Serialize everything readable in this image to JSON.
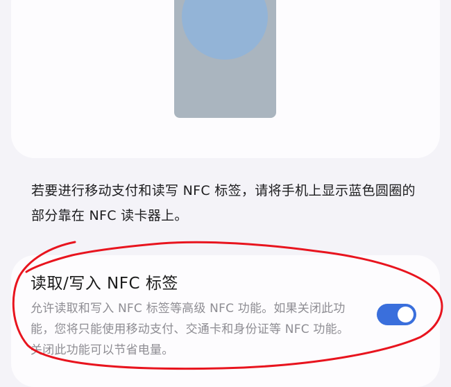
{
  "instruction": {
    "text": "若要进行移动支付和读写 NFC 标签，请将手机上显示蓝色圆圈的部分靠在 NFC 读卡器上。"
  },
  "setting": {
    "title": "读取/写入 NFC 标签",
    "description": "允许读取和写入 NFC 标签等高级 NFC 功能。如果关闭此功能，您将只能使用移动支付、交通卡和身份证等 NFC 功能。关闭此功能可以节省电量。",
    "toggle_on": true
  },
  "colors": {
    "accent": "#3a6fdc",
    "annotation": "#e8141e",
    "nfc_circle": "#93b4d7"
  }
}
